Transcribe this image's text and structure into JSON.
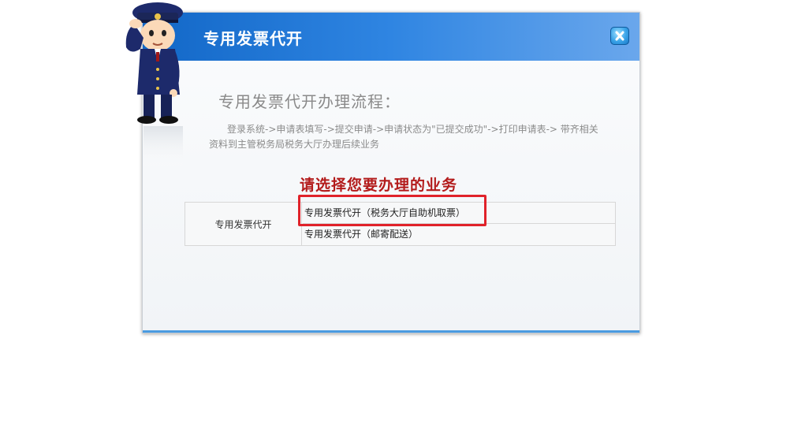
{
  "dialog": {
    "title": "专用发票代开",
    "close_icon": "close-x-icon"
  },
  "process": {
    "title": "专用发票代开办理流程：",
    "steps_text": "登录系统->申请表填写->提交申请->申请状态为\"已提交成功\"->打印申请表-> 带齐相关资料到主管税务局税务大厅办理后续业务"
  },
  "selection": {
    "prompt": "请选择您要办理的业务",
    "category": "专用发票代开",
    "options": [
      {
        "label": "专用发票代开（税务大厅自助机取票）"
      },
      {
        "label": "专用发票代开（邮寄配送）"
      }
    ]
  },
  "colors": {
    "header_blue": "#1267c7",
    "prompt_red": "#b31b1b",
    "highlight_red": "#e0222a"
  }
}
